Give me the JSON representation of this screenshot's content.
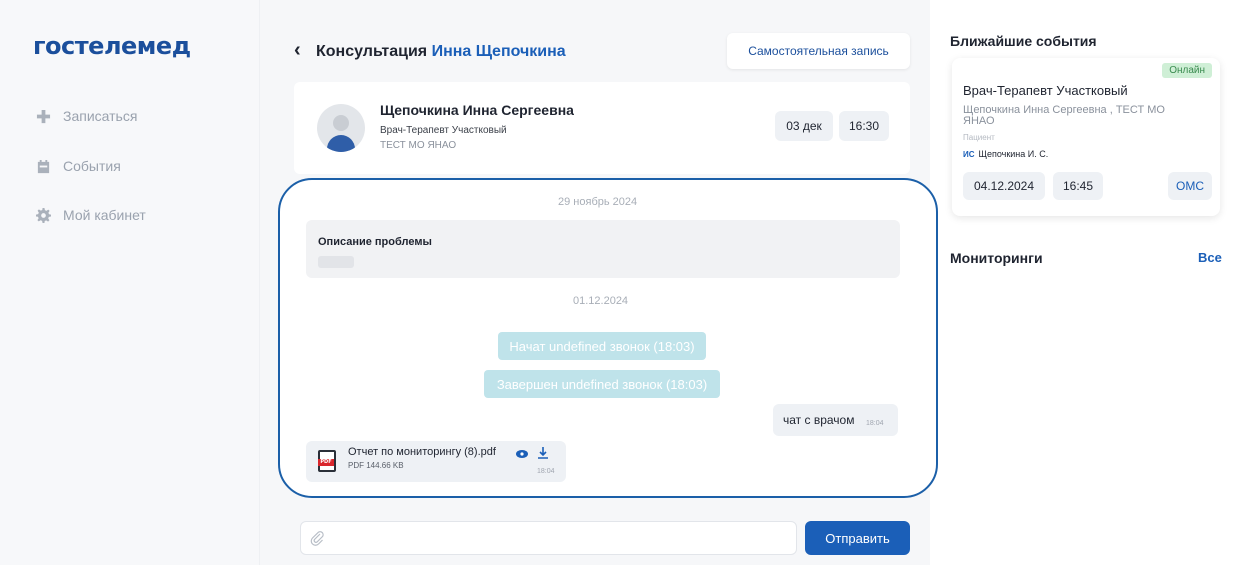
{
  "sidebar": {
    "logo": "гостелемед",
    "items": [
      {
        "label": "Записаться",
        "icon": "plus-icon"
      },
      {
        "label": "События",
        "icon": "calendar-icon"
      },
      {
        "label": "Мой кабинет",
        "icon": "gear-icon"
      }
    ]
  },
  "header": {
    "title_prefix": "Консультация",
    "title_name": "Инна Щепочкина",
    "self_record_label": "Самостоятельная запись"
  },
  "doctor": {
    "name": "Щепочкина Инна Сергеевна",
    "role": "Врач-Терапевт Участковый",
    "org": "ТЕСТ МО ЯНАО",
    "date": "03 дек",
    "time": "16:30"
  },
  "chat": {
    "date1": "29 ноябрь 2024",
    "problem_title": "Описание проблемы",
    "date2": "01.12.2024",
    "system_messages": [
      "Начат undefined звонок (18:03)",
      "Завершен undefined звонок (18:03)"
    ],
    "user_message": {
      "text": "чат с врачом",
      "time": "18:04"
    },
    "file": {
      "name": "Отчет по мониторингу (8).pdf",
      "meta": "PDF 144.66 KB",
      "time": "18:04",
      "icon_label": "PDF"
    }
  },
  "composer": {
    "placeholder": "",
    "send_label": "Отправить"
  },
  "right": {
    "events_title": "Ближайшие события",
    "event": {
      "badge": "Онлайн",
      "title": "Врач-Терапевт Участковый",
      "subtitle": "Щепочкина Инна Сергеевна , ТЕСТ МО ЯНАО",
      "role_label": "Пациент",
      "patient_initials": "ИС",
      "patient_name": "Щепочкина И. С.",
      "date": "04.12.2024",
      "time": "16:45",
      "payment": "ОМС"
    },
    "monitoring_title": "Мониторинги",
    "monitoring_all": "Все"
  },
  "colors": {
    "brand": "#1b5fb8",
    "logo": "#1b4f9c",
    "highlight_border": "#1b5fa8",
    "system_msg_bg": "#bfe3ea",
    "online_badge_bg": "#cfefd6"
  }
}
